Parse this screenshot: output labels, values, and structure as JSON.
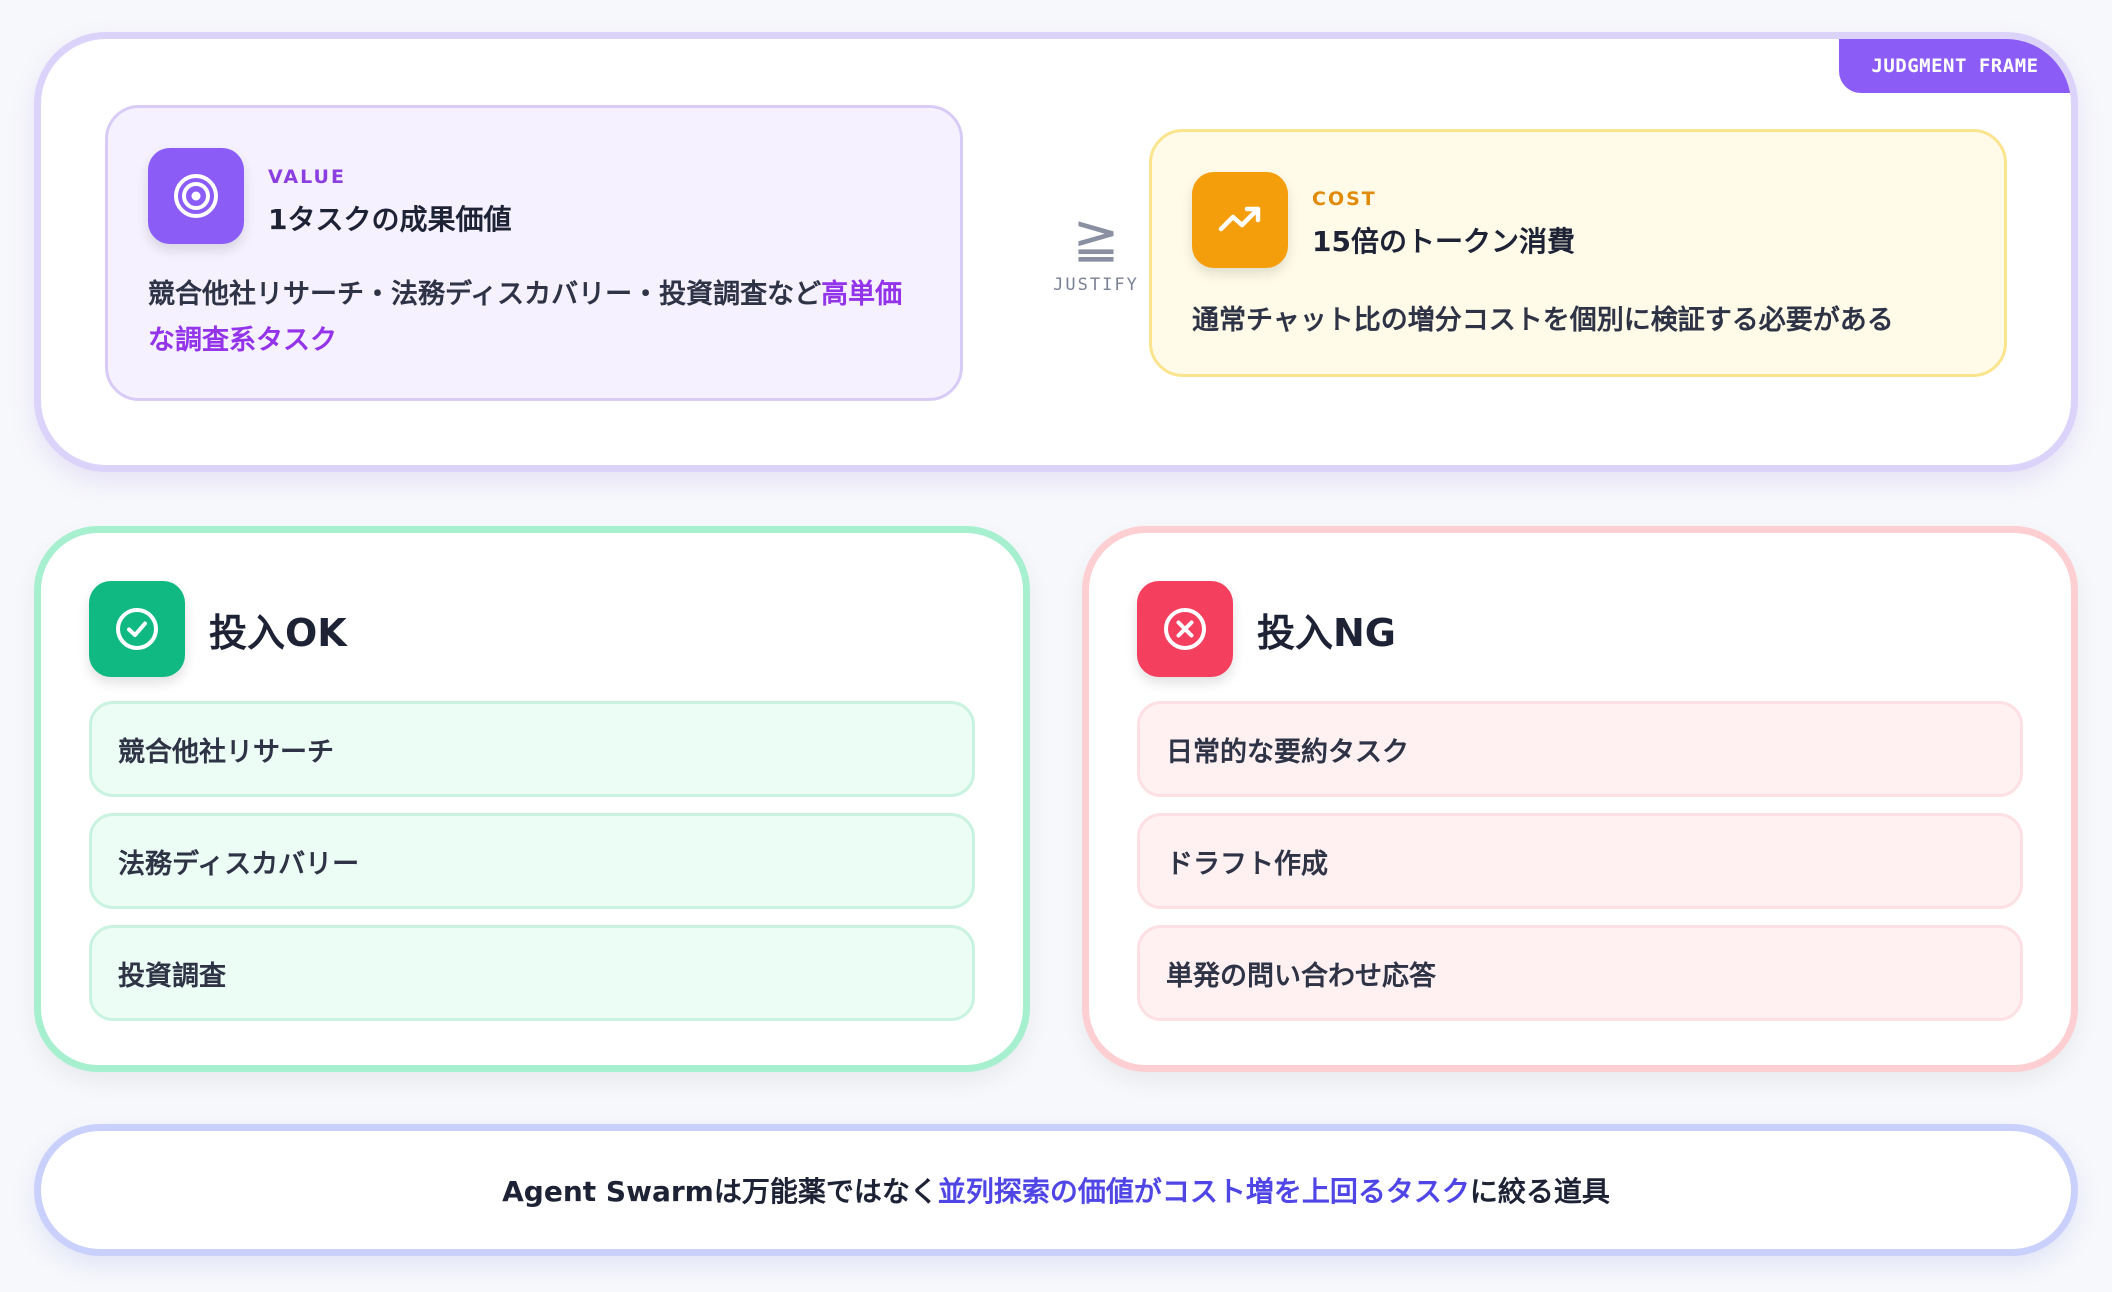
{
  "frame": {
    "badge": "JUDGMENT FRAME"
  },
  "value_card": {
    "icon": "target-icon",
    "kicker": "VALUE",
    "title": "1タスクの成果価値",
    "desc_plain": "競合他社リサーチ・法務ディスカバリー・投資調査など",
    "desc_highlight": "高単価な調査系タスク"
  },
  "relation": {
    "symbol": "≧",
    "label": "JUSTIFY"
  },
  "cost_card": {
    "icon": "trending-up-icon",
    "kicker": "COST",
    "title": "15倍のトークン消費",
    "desc": "通常チャット比の増分コストを個別に検証する必要がある"
  },
  "ok_panel": {
    "icon": "check-circle-icon",
    "title": "投入OK",
    "items": [
      "競合他社リサーチ",
      "法務ディスカバリー",
      "投資調査"
    ]
  },
  "ng_panel": {
    "icon": "x-circle-icon",
    "title": "投入NG",
    "items": [
      "日常的な要約タスク",
      "ドラフト作成",
      "単発の問い合わせ応答"
    ]
  },
  "conclusion": {
    "prefix": "Agent Swarmは万能薬ではなく",
    "highlight": "並列探索の価値がコスト増を上回るタスク",
    "suffix": "に絞る道具"
  },
  "colors": {
    "value_accent": "#8b5cf6",
    "cost_accent": "#f59e0b",
    "ok_accent": "#10b981",
    "ng_accent": "#f43f5e",
    "conclusion_highlight": "#4f46e5"
  }
}
